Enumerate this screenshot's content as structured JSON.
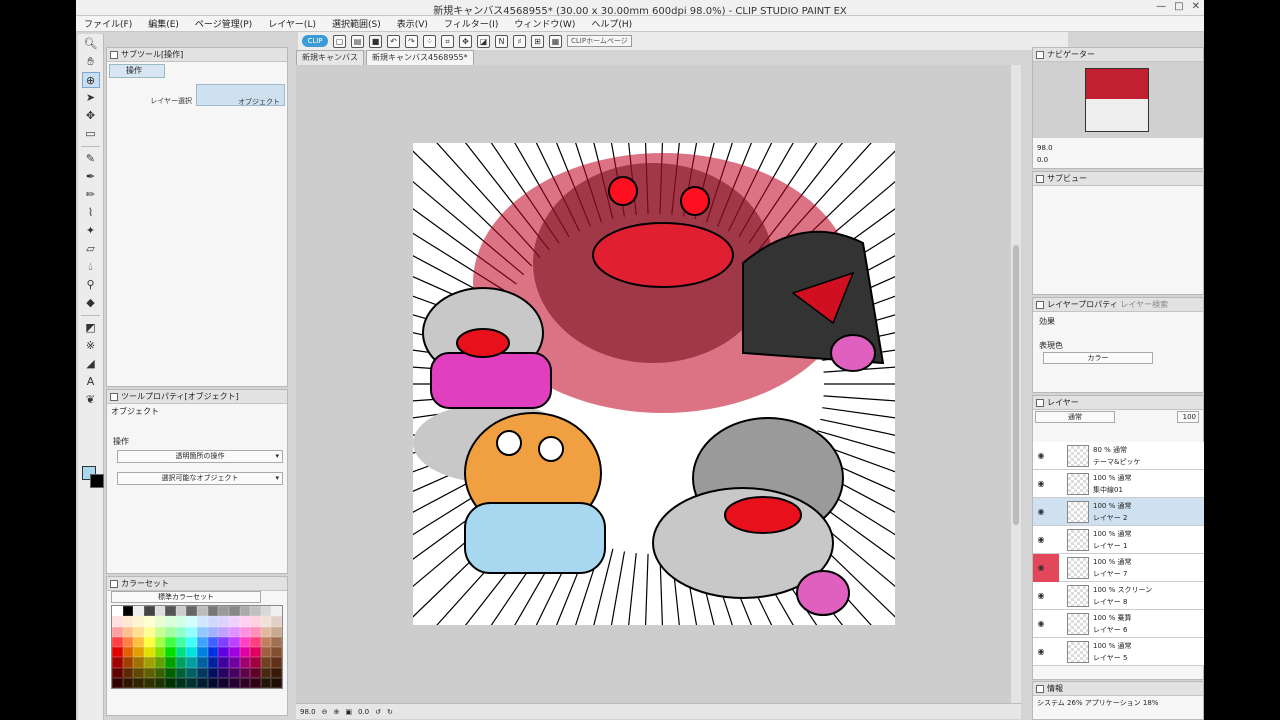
{
  "window": {
    "title": "新規キャンバス4568955* (30.00 x 30.00mm 600dpi 98.0%)  - CLIP STUDIO PAINT EX"
  },
  "menu": [
    "ファイル(F)",
    "編集(E)",
    "ページ管理(P)",
    "レイヤー(L)",
    "選択範囲(S)",
    "表示(V)",
    "フィルター(I)",
    "ウィンドウ(W)",
    "ヘルプ(H)"
  ],
  "command_bar": {
    "clip_label": "CLIP",
    "home_label": "CLIPホームページ"
  },
  "subtool_panel": {
    "title": "サブツール[操作]",
    "tab_label": "操作",
    "options": [
      "レイヤー選択",
      "オブジェクト"
    ]
  },
  "tool_property": {
    "title": "ツールプロパティ[オブジェクト]",
    "subtitle": "オブジェクト",
    "section_label": "操作",
    "select1": "透明箇所の操作",
    "select2": "選択可能なオブジェクト"
  },
  "color_set": {
    "title": "カラーセット",
    "set_name": "標準カラーセット"
  },
  "canvas": {
    "tabs": [
      "新規キャンバス",
      "新規キャンバス4568955*"
    ],
    "zoom": "98.0",
    "rotation": "0.0"
  },
  "navigator": {
    "title": "ナビゲーター",
    "zoom": "98.0",
    "rotation": "0.0"
  },
  "sub_view": {
    "title": "サブビュー"
  },
  "layer_property": {
    "title": "レイヤープロパティ",
    "search_tab": "レイヤー検索",
    "effect_label": "効果",
    "color_label": "表現色",
    "color_value": "カラー"
  },
  "layers": {
    "title": "レイヤー",
    "blend_mode": "通常",
    "opacity": "100",
    "items": [
      {
        "mode": "80 % 通常",
        "name": "テーマ&ピッケ"
      },
      {
        "mode": "100 % 通常",
        "name": "集中線01"
      },
      {
        "mode": "100 % 通常",
        "name": "レイヤー 2"
      },
      {
        "mode": "100 % 通常",
        "name": "レイヤー 1"
      },
      {
        "mode": "100 % 通常",
        "name": "レイヤー 7"
      },
      {
        "mode": "100 % スクリーン",
        "name": "レイヤー 8"
      },
      {
        "mode": "100 % 乗算",
        "name": "レイヤー 6"
      },
      {
        "mode": "100 % 通常",
        "name": "レイヤー 5"
      }
    ]
  },
  "info": {
    "title": "情報",
    "text": "システム 26%  アプリケーション 18%"
  },
  "colors": {
    "main_color": "#a8d8f0",
    "sub_color": "#000000",
    "selected_layer_bg": "#cfe0f0",
    "accent_red": "#e4475a"
  }
}
